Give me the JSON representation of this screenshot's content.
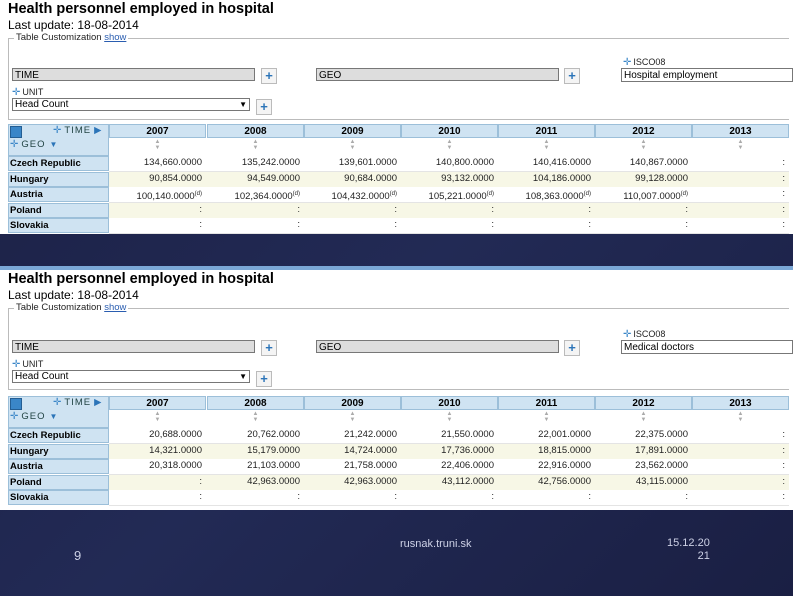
{
  "panels": [
    {
      "title": "Health personnel employed in hospital",
      "last_update": "Last update: 18-08-2014",
      "customization_label": "Table Customization",
      "customization_link": "show",
      "time_field": "TIME",
      "geo_field": "GEO",
      "isco_label": "ISCO08",
      "isco_value": "Hospital employment",
      "unit_label": "UNIT",
      "unit_value": "Head Count",
      "time_axis_label": "TIME",
      "geo_axis_label": "GEO",
      "years": [
        "2007",
        "2008",
        "2009",
        "2010",
        "2011",
        "2012",
        "2013"
      ],
      "rows": [
        {
          "country": "Czech Republic",
          "values": [
            "134,660.0000",
            "135,242.0000",
            "139,601.0000",
            "140,800.0000",
            "140,416.0000",
            "140,867.0000",
            ":"
          ],
          "flags": [
            "",
            "",
            "",
            "",
            "",
            "",
            ""
          ]
        },
        {
          "country": "Hungary",
          "values": [
            "90,854.0000",
            "94,549.0000",
            "90,684.0000",
            "93,132.0000",
            "104,186.0000",
            "99,128.0000",
            ":"
          ],
          "flags": [
            "",
            "",
            "",
            "",
            "",
            "",
            ""
          ]
        },
        {
          "country": "Austria",
          "values": [
            "100,140.0000",
            "102,364.0000",
            "104,432.0000",
            "105,221.0000",
            "108,363.0000",
            "110,007.0000",
            ":"
          ],
          "flags": [
            "(d)",
            "(d)",
            "(d)",
            "(d)",
            "(d)",
            "(d)",
            ""
          ]
        },
        {
          "country": "Poland",
          "values": [
            ":",
            ":",
            ":",
            ":",
            ":",
            ":",
            ":"
          ],
          "flags": [
            "",
            "",
            "",
            "",
            "",
            "",
            ""
          ]
        },
        {
          "country": "Slovakia",
          "values": [
            ":",
            ":",
            ":",
            ":",
            ":",
            ":",
            ":"
          ],
          "flags": [
            "",
            "",
            "",
            "",
            "",
            "",
            ""
          ]
        }
      ]
    },
    {
      "title": "Health personnel employed in hospital",
      "last_update": "Last update: 18-08-2014",
      "customization_label": "Table Customization",
      "customization_link": "show",
      "time_field": "TIME",
      "geo_field": "GEO",
      "isco_label": "ISCO08",
      "isco_value": "Medical doctors",
      "unit_label": "UNIT",
      "unit_value": "Head Count",
      "time_axis_label": "TIME",
      "geo_axis_label": "GEO",
      "years": [
        "2007",
        "2008",
        "2009",
        "2010",
        "2011",
        "2012",
        "2013"
      ],
      "rows": [
        {
          "country": "Czech Republic",
          "values": [
            "20,688.0000",
            "20,762.0000",
            "21,242.0000",
            "21,550.0000",
            "22,001.0000",
            "22,375.0000",
            ":"
          ],
          "flags": [
            "",
            "",
            "",
            "",
            "",
            "",
            ""
          ]
        },
        {
          "country": "Hungary",
          "values": [
            "14,321.0000",
            "15,179.0000",
            "14,724.0000",
            "17,736.0000",
            "18,815.0000",
            "17,891.0000",
            ":"
          ],
          "flags": [
            "",
            "",
            "",
            "",
            "",
            "",
            ""
          ]
        },
        {
          "country": "Austria",
          "values": [
            "20,318.0000",
            "21,103.0000",
            "21,758.0000",
            "22,406.0000",
            "22,916.0000",
            "23,562.0000",
            ":"
          ],
          "flags": [
            "",
            "",
            "",
            "",
            "",
            "",
            ""
          ]
        },
        {
          "country": "Poland",
          "values": [
            ":",
            "42,963.0000",
            "42,963.0000",
            "43,112.0000",
            "42,756.0000",
            "43,115.0000",
            ":"
          ],
          "flags": [
            "",
            "",
            "",
            "",
            "",
            "",
            ""
          ]
        },
        {
          "country": "Slovakia",
          "values": [
            ":",
            ":",
            ":",
            ":",
            ":",
            ":",
            ":"
          ],
          "flags": [
            "",
            "",
            "",
            "",
            "",
            "",
            ""
          ]
        }
      ]
    }
  ],
  "footer": {
    "slide_number": "9",
    "site": "rusnak.truni.sk",
    "date_line1": "15.12.20",
    "date_line2": "21"
  },
  "colors": {
    "background": "#1f2550",
    "header_blue": "#cfe3f2",
    "accent": "#3a86c8",
    "band_yellow": "#f7f7e6"
  },
  "icons": [
    "move-icon",
    "plus-icon",
    "sort-icon",
    "grid-icon",
    "dropdown-arrow-icon",
    "play-arrow-icon"
  ]
}
